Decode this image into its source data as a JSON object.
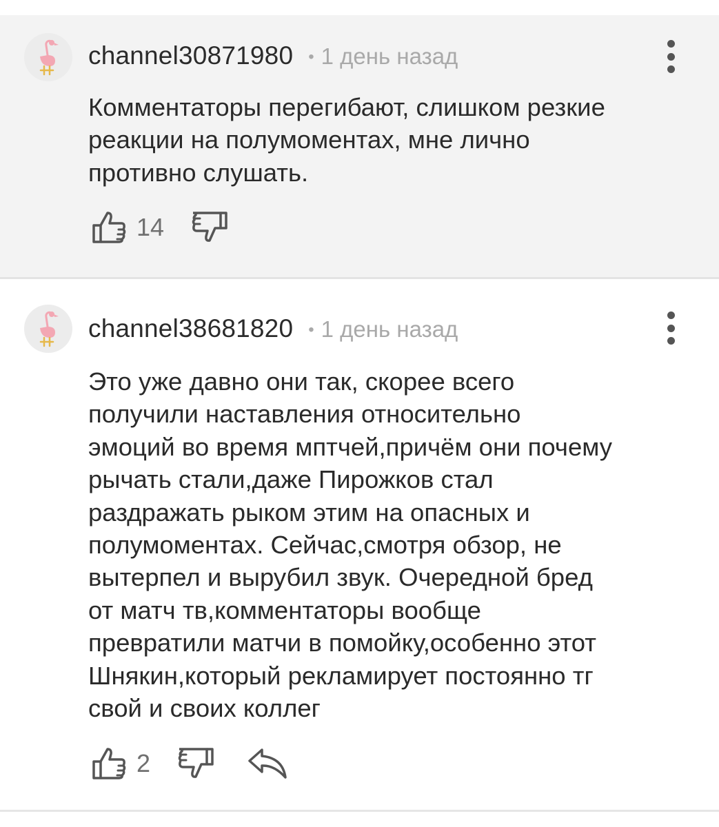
{
  "comments": [
    {
      "username": "channel30871980",
      "separator": "•",
      "time": "1 день назад",
      "text": "Комментаторы перегибают, слишком резкие\nреакции на полумоментах, мне лично\nпротивно слушать.",
      "likes": "14",
      "avatar_icon": "flamingo-icon"
    },
    {
      "username": "channel38681820",
      "separator": "•",
      "time": "1 день назад",
      "text": "Это уже давно они так, скорее всего\nполучили наставления относительно\nэмоций во время мптчей,причём они почему\nрычать стали,даже Пирожков стал\nраздражать рыком этим на опасных и\nполумоментах. Сейчас,смотря обзор, не\nвытерпел и вырубил звук. Очередной бред\nот матч тв,комментаторы вообще\nпревратили матчи в помойку,особенно этот\nШнякин,который рекламирует постоянно тг\nсвой и своих коллег",
      "likes": "2",
      "avatar_icon": "flamingo-icon"
    }
  ],
  "icons": {
    "like": "thumbs-up-icon",
    "dislike": "thumbs-down-icon",
    "reply": "reply-icon",
    "menu": "more-vertical-icon"
  },
  "colors": {
    "highlight_bg": "#f3f3f3",
    "flamingo": "#f3a7b3",
    "flamingo_legs": "#e6b84a"
  }
}
